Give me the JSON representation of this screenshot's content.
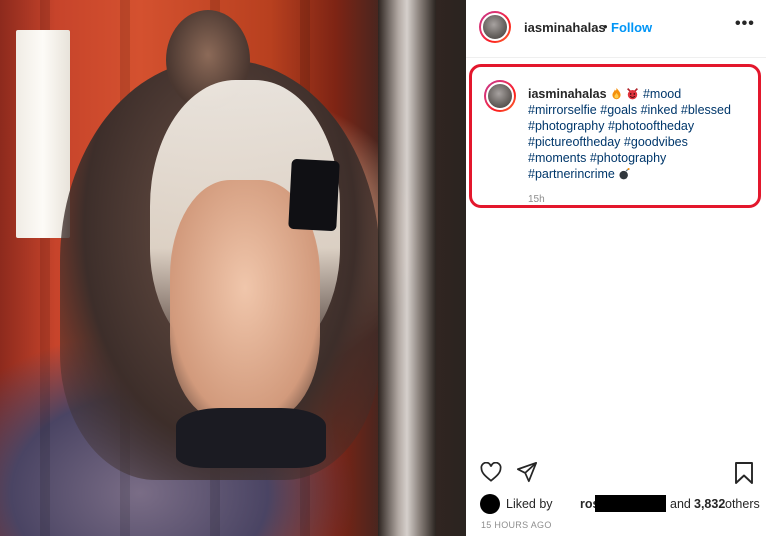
{
  "post": {
    "username": "iasminahalas",
    "separator": "•",
    "follow_label": "Follow",
    "more_icon": "more-options-icon",
    "more_glyph": "•••"
  },
  "caption": {
    "username": "iasminahalas",
    "emojis": [
      "fire-emoji",
      "devil-emoji",
      "bomb-emoji"
    ],
    "hashtags": [
      "#mood",
      "#mirrorselfie",
      "#goals",
      "#inked",
      "#blessed",
      "#photography",
      "#photooftheday",
      "#pictureoftheday",
      "#goodvibes",
      "#moments",
      "#photography",
      "#partnerincrime"
    ],
    "time": "15h",
    "highlight_color": "#e3172c"
  },
  "actions": {
    "like_icon": "heart-icon",
    "share_icon": "paper-plane-icon",
    "save_icon": "bookmark-icon"
  },
  "likes": {
    "prefix": "Liked by",
    "liker_visible": "rose",
    "connector": "and",
    "count": "3,832",
    "suffix": "others"
  },
  "timestamp": "15 HOURS AGO",
  "colors": {
    "link_blue": "#0095f6",
    "hashtag_blue": "#00376b",
    "muted_gray": "#8e8e8e"
  }
}
